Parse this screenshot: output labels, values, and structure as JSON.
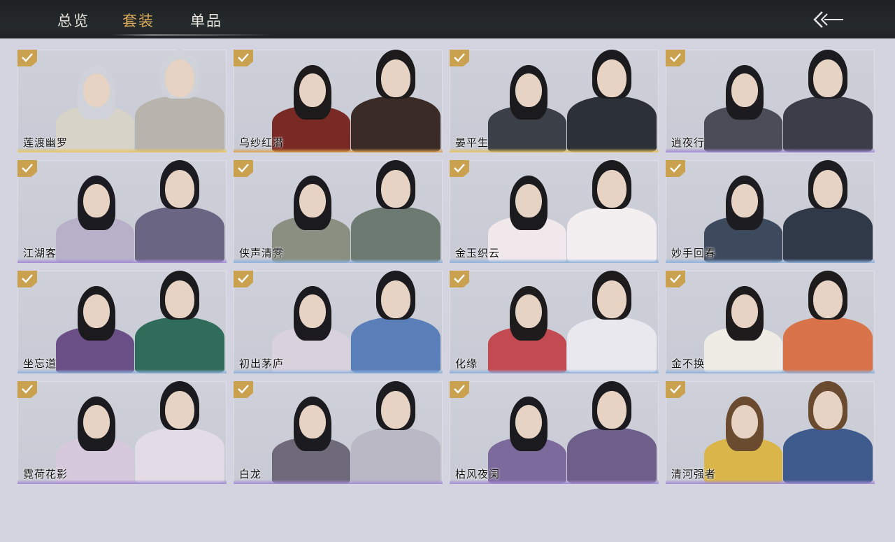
{
  "header": {
    "tabs": [
      {
        "label": "总览",
        "active": false
      },
      {
        "label": "套装",
        "active": true
      },
      {
        "label": "单品",
        "active": false
      }
    ],
    "back_icon": "back-arrow-icon"
  },
  "accent_color": "#d9a95c",
  "check_color": "#c9a14f",
  "outfits": [
    {
      "name": "莲渡幽罗",
      "owned": true,
      "glow": "#e9c85a"
    },
    {
      "name": "乌纱红潸",
      "owned": true,
      "glow": "#d9a24a"
    },
    {
      "name": "晏平生",
      "owned": true,
      "glow": "#e6c35c"
    },
    {
      "name": "逍夜行",
      "owned": true,
      "glow": "#a48bd6"
    },
    {
      "name": "江湖客",
      "owned": true,
      "glow": "#a48bd6"
    },
    {
      "name": "侠声清霁",
      "owned": true,
      "glow": "#8fb1dc"
    },
    {
      "name": "金玉织云",
      "owned": true,
      "glow": "#8fb1dc"
    },
    {
      "name": "妙手回春",
      "owned": true,
      "glow": "#8fb1dc"
    },
    {
      "name": "坐忘道",
      "owned": true,
      "glow": "#8fb1dc"
    },
    {
      "name": "初出茅庐",
      "owned": true,
      "glow": "#8fb1dc"
    },
    {
      "name": "化缘",
      "owned": true,
      "glow": "#8fb1dc"
    },
    {
      "name": "金不换",
      "owned": true,
      "glow": "#8fb1dc"
    },
    {
      "name": "霓荷花影",
      "owned": true,
      "glow": "#a48bd6"
    },
    {
      "name": "白龙",
      "owned": true,
      "glow": "#a48bd6"
    },
    {
      "name": "枯风夜阑",
      "owned": true,
      "glow": "#a48bd6"
    },
    {
      "name": "清河强者",
      "owned": true,
      "glow": "#a48bd6"
    }
  ]
}
